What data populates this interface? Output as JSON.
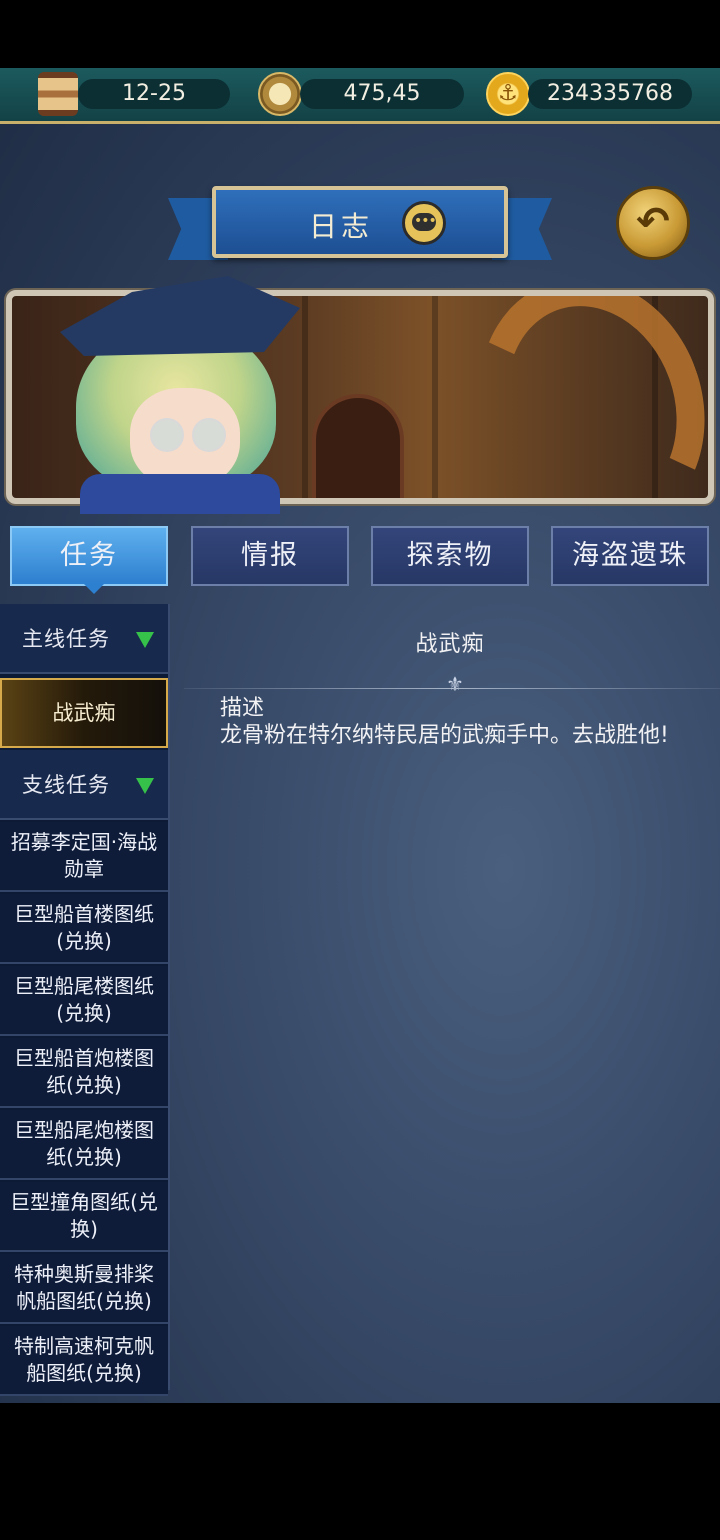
{
  "resources": {
    "date": "12-25",
    "coordinates": "475,45",
    "gold": "234335768"
  },
  "header": {
    "title": "日志"
  },
  "tabs": [
    {
      "label": "任务",
      "active": true
    },
    {
      "label": "情报",
      "active": false
    },
    {
      "label": "探索物",
      "active": false
    },
    {
      "label": "海盗遗珠",
      "active": false
    }
  ],
  "sidebar": {
    "main_category": "主线任务",
    "selected_quest": "战武痴",
    "side_category": "支线任务",
    "side_quests": [
      "招募李定国·海战勋章",
      "巨型船首楼图纸(兑换)",
      "巨型船尾楼图纸(兑换)",
      "巨型船首炮楼图纸(兑换)",
      "巨型船尾炮楼图纸(兑换)",
      "巨型撞角图纸(兑换)",
      "特种奥斯曼排桨帆船图纸(兑换)",
      "特制高速柯克帆船图纸(兑换)"
    ]
  },
  "detail": {
    "title": "战武痴",
    "description_label": "描述",
    "description": "龙骨粉在特尔纳特民居的武痴手中。去战胜他!"
  },
  "icons": {
    "date": "hourglass-icon",
    "coordinates": "compass-icon",
    "gold": "anchor-coin-icon",
    "title": "chat-bubble-icon",
    "back": "back-arrow-icon",
    "expand": "triangle-down-icon"
  },
  "colors": {
    "accent_tab": "#2d7fcf",
    "expand_triangle": "#36c24a",
    "selected_border": "#d6a94a"
  }
}
